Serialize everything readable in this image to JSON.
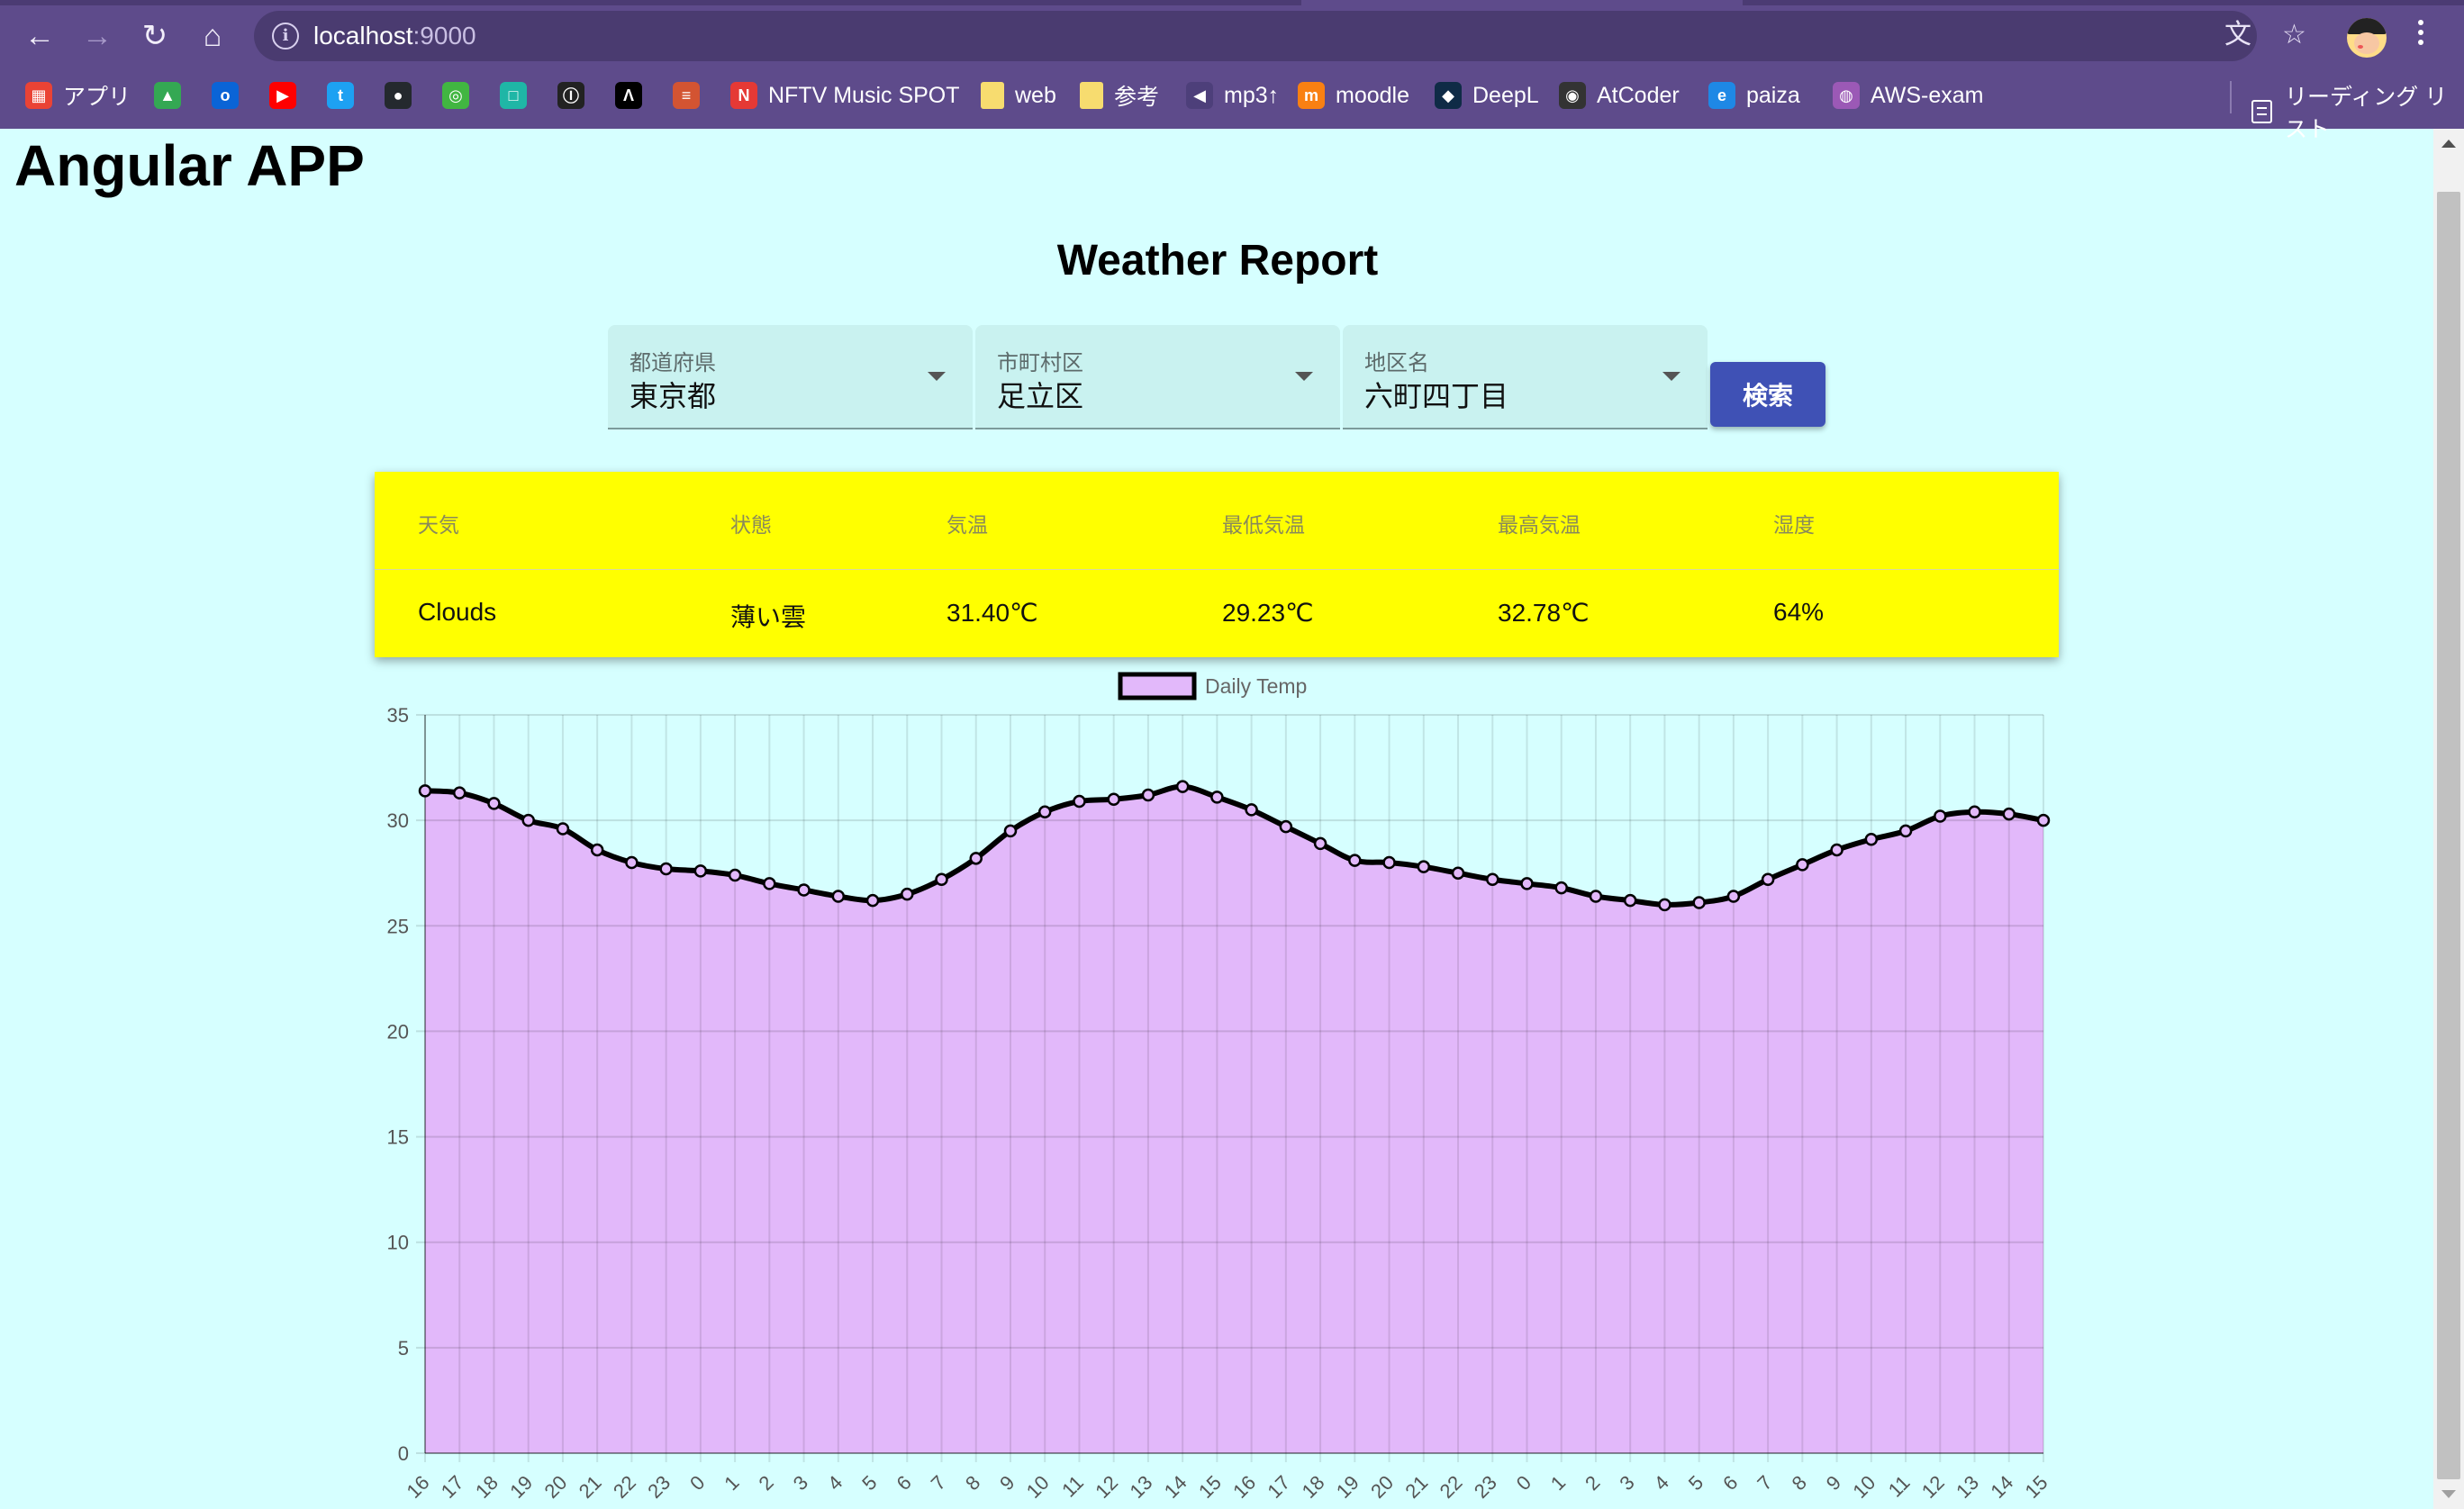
{
  "browser": {
    "url_host": "localhost",
    "url_port": ":9000",
    "bookmarks": [
      {
        "label": "アプリ",
        "icon": "apps-grid-icon",
        "color": "#ea4335"
      },
      {
        "label": "",
        "icon": "google-drive-icon",
        "color": "#34a853"
      },
      {
        "label": "",
        "icon": "outlook-icon",
        "color": "#0a64d6"
      },
      {
        "label": "",
        "icon": "youtube-icon",
        "color": "#ff0000"
      },
      {
        "label": "",
        "icon": "twitter-icon",
        "color": "#1da1f2"
      },
      {
        "label": "",
        "icon": "github-icon",
        "color": "#24292e"
      },
      {
        "label": "",
        "icon": "green-circle-icon",
        "color": "#41b641"
      },
      {
        "label": "",
        "icon": "teal-square-icon",
        "color": "#1fb6a6"
      },
      {
        "label": "",
        "icon": "info-circle-icon",
        "color": "#222222"
      },
      {
        "label": "",
        "icon": "atcoder-a-icon",
        "color": "#000000"
      },
      {
        "label": "",
        "icon": "stackoverflow-icon",
        "color": "#d35432"
      },
      {
        "label": "NFTV Music SPOT",
        "icon": "nftv-icon",
        "color": "#e53935"
      },
      {
        "label": "web",
        "icon": "folder-icon",
        "color": "#f7dc6f"
      },
      {
        "label": "参考",
        "icon": "folder-icon",
        "color": "#f7dc6f"
      },
      {
        "label": "mp3↑",
        "icon": "mp3-icon",
        "color": "#4d3f7a"
      },
      {
        "label": "moodle",
        "icon": "moodle-icon",
        "color": "#f98012"
      },
      {
        "label": "DeepL",
        "icon": "deepl-icon",
        "color": "#0f2b46"
      },
      {
        "label": "AtCoder",
        "icon": "atcoder-icon",
        "color": "#333333"
      },
      {
        "label": "paiza",
        "icon": "paiza-icon",
        "color": "#1e88e5"
      },
      {
        "label": "AWS-exam",
        "icon": "globe-icon",
        "color": "#9b59b6"
      }
    ],
    "reading_list": "リーディング リスト"
  },
  "app": {
    "title": "Angular APP",
    "heading": "Weather Report"
  },
  "form": {
    "prefecture": {
      "label": "都道府県",
      "value": "東京都"
    },
    "city": {
      "label": "市町村区",
      "value": "足立区"
    },
    "district": {
      "label": "地区名",
      "value": "六町四丁目"
    },
    "search_label": "検索"
  },
  "weather": {
    "headers": [
      "天気",
      "状態",
      "気温",
      "最低気温",
      "最高気温",
      "湿度"
    ],
    "values": [
      "Clouds",
      "薄い雲",
      "31.40℃",
      "29.23℃",
      "32.78℃",
      "64%"
    ]
  },
  "colors": {
    "accent": "#3f51b5",
    "card": "#ffff00",
    "page_bg": "#d6ffff",
    "chart_fill": "#e2b8fa",
    "chart_line": "#000000"
  },
  "chart_data": {
    "type": "line",
    "title": "",
    "legend": "Daily Temp",
    "legend_position": "top",
    "fill": true,
    "grid": true,
    "ylim": [
      0,
      35
    ],
    "yticks": [
      0,
      5,
      10,
      15,
      20,
      25,
      30,
      35
    ],
    "categories": [
      "16",
      "17",
      "18",
      "19",
      "20",
      "21",
      "22",
      "23",
      "0",
      "1",
      "2",
      "3",
      "4",
      "5",
      "6",
      "7",
      "8",
      "9",
      "10",
      "11",
      "12",
      "13",
      "14",
      "15",
      "16",
      "17",
      "18",
      "19",
      "20",
      "21",
      "22",
      "23",
      "0",
      "1",
      "2",
      "3",
      "4",
      "5",
      "6",
      "7",
      "8",
      "9",
      "10",
      "11",
      "12",
      "13",
      "14",
      "15"
    ],
    "series": [
      {
        "name": "Daily Temp",
        "values": [
          31.4,
          31.3,
          30.8,
          30.0,
          29.6,
          28.6,
          28.0,
          27.7,
          27.6,
          27.4,
          27.0,
          26.7,
          26.4,
          26.2,
          26.5,
          27.2,
          28.2,
          29.5,
          30.4,
          30.9,
          31.0,
          31.2,
          31.6,
          31.1,
          30.5,
          29.7,
          28.9,
          28.1,
          28.0,
          27.8,
          27.5,
          27.2,
          27.0,
          26.8,
          26.4,
          26.2,
          26.0,
          26.1,
          26.4,
          27.2,
          27.9,
          28.6,
          29.1,
          29.5,
          30.2,
          30.4,
          30.3,
          30.0
        ]
      }
    ]
  }
}
